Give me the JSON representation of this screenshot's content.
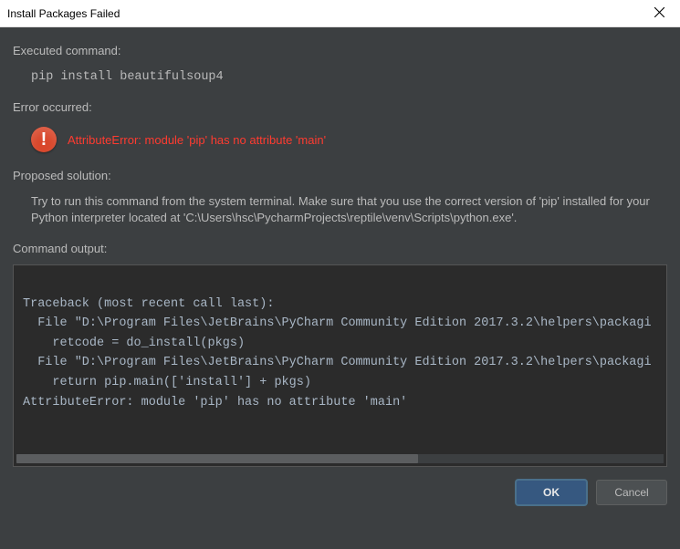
{
  "window": {
    "title": "Install Packages Failed"
  },
  "sections": {
    "executed_label": "Executed command:",
    "executed_command": "pip install beautifulsoup4",
    "error_label": "Error occurred:",
    "error_message": "AttributeError: module 'pip' has no attribute 'main'",
    "solution_label": "Proposed solution:",
    "solution_text": "Try to run this command from the system terminal. Make sure that you use the correct version of 'pip' installed for your Python interpreter located at 'C:\\Users\\hsc\\PycharmProjects\\reptile\\venv\\Scripts\\python.exe'.",
    "output_label": "Command output:",
    "output_text": "\nTraceback (most recent call last):\n  File \"D:\\Program Files\\JetBrains\\PyCharm Community Edition 2017.3.2\\helpers\\packagi\n    retcode = do_install(pkgs)\n  File \"D:\\Program Files\\JetBrains\\PyCharm Community Edition 2017.3.2\\helpers\\packagi\n    return pip.main(['install'] + pkgs)\nAttributeError: module 'pip' has no attribute 'main'"
  },
  "buttons": {
    "ok": "OK",
    "cancel": "Cancel"
  }
}
